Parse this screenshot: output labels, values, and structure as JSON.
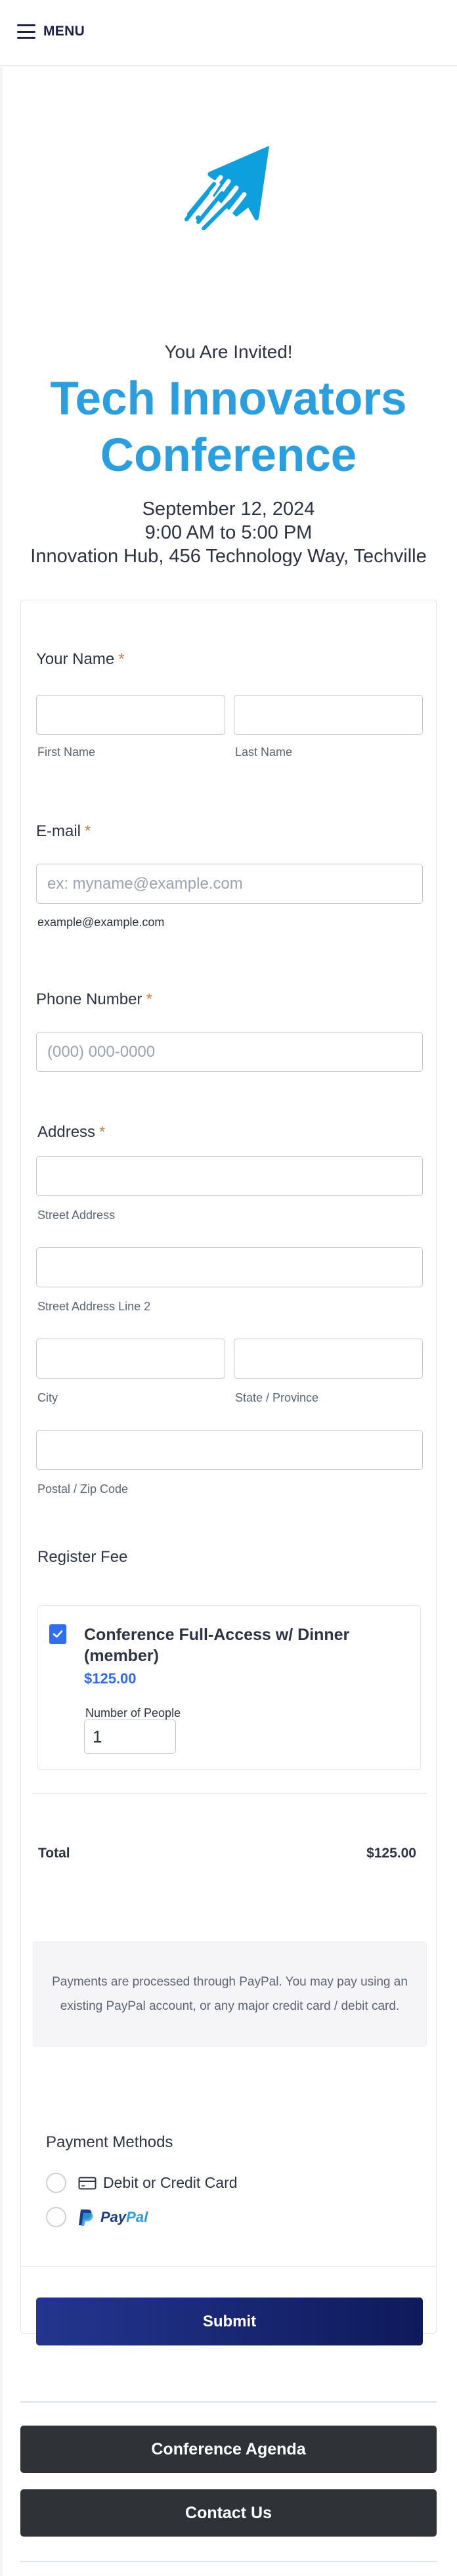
{
  "header": {
    "menu_label": "MENU"
  },
  "hero": {
    "invited": "You Are Invited!",
    "title": "Tech Innovators Conference",
    "date": "September 12, 2024",
    "time": "9:00 AM to 5:00 PM",
    "location": "Innovation Hub, 456 Technology Way, Techville"
  },
  "form": {
    "name": {
      "label": "Your Name",
      "required_mark": "*",
      "first_sublabel": "First Name",
      "last_sublabel": "Last Name",
      "first_value": "",
      "last_value": ""
    },
    "email": {
      "label": "E-mail",
      "required_mark": "*",
      "placeholder": "ex: myname@example.com",
      "sublabel": "example@example.com",
      "value": ""
    },
    "phone": {
      "label": "Phone Number",
      "required_mark": "*",
      "placeholder": "(000) 000-0000",
      "value": ""
    },
    "address": {
      "label": "Address",
      "required_mark": "*",
      "street_sublabel": "Street Address",
      "street2_sublabel": "Street Address Line 2",
      "city_sublabel": "City",
      "state_sublabel": "State / Province",
      "zip_sublabel": "Postal / Zip Code"
    },
    "register_fee": {
      "label": "Register Fee",
      "product": {
        "name": "Conference Full-Access w/ Dinner (member)",
        "price": "$125.00",
        "checked": true,
        "qty_label": "Number of People",
        "qty_value": "1"
      }
    },
    "total": {
      "label": "Total",
      "value": "$125.00"
    },
    "payment_note": "Payments are processed through PayPal.  You may pay using an existing PayPal account, or any major credit card / debit card.",
    "payment_methods": {
      "title": "Payment Methods",
      "options": [
        {
          "label": "Debit or Credit Card",
          "icon": "credit-card-icon",
          "selected": false
        },
        {
          "label_pay": "Pay",
          "label_pal": "Pal",
          "icon": "paypal-logo-icon",
          "selected": false
        }
      ]
    },
    "submit_label": "Submit"
  },
  "footer": {
    "agenda_label": "Conference Agenda",
    "contact_label": "Contact Us"
  },
  "colors": {
    "accent": "#2a9fdf",
    "required": "#d07b3c",
    "price": "#2f6df6",
    "submit_start": "#24358f",
    "submit_end": "#0e1a5a",
    "dark_button": "#2f3237"
  }
}
